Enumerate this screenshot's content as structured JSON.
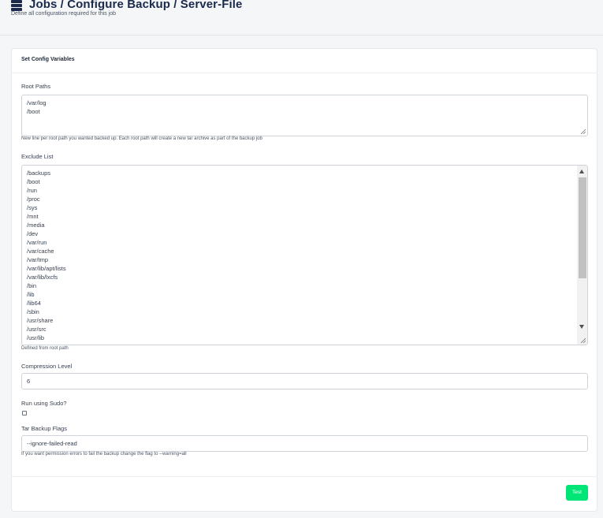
{
  "header": {
    "title": "Jobs / Configure Backup / Server-File",
    "subtitle": "Define all configuration required for this job",
    "icon": "database-icon"
  },
  "card": {
    "title": "Set Config Variables"
  },
  "root_paths": {
    "label": "Root Paths",
    "lines": [
      "/var/log",
      "/boot"
    ],
    "help": "New line per root path you wanted backed up. Each root path will create a new tar archive as part of the backup job"
  },
  "exclude_list": {
    "label": "Exclude List",
    "lines": [
      "/backups",
      "/boot",
      "/run",
      "/proc",
      "/sys",
      "/mnt",
      "/media",
      "/dev",
      "/var/run",
      "/var/cache",
      "/var/tmp",
      "/var/lib/apt/lists",
      "/var/lib/lxcfs",
      "/bin",
      "/lib",
      "/lib64",
      "/sbin",
      "/usr/share",
      "/usr/src",
      "/usr/lib"
    ],
    "help": "Defined from root path"
  },
  "compression": {
    "label": "Compression Level",
    "value": "6"
  },
  "sudo": {
    "label": "Run using Sudo?",
    "checked": false
  },
  "tar_flags": {
    "label": "Tar Backup Flags",
    "value": "--ignore-failed-read",
    "help": "If you want permission errors to fail the backup change the flag to --warning=all"
  },
  "footer": {
    "test_label": "Test",
    "button_color": "#00e676"
  }
}
